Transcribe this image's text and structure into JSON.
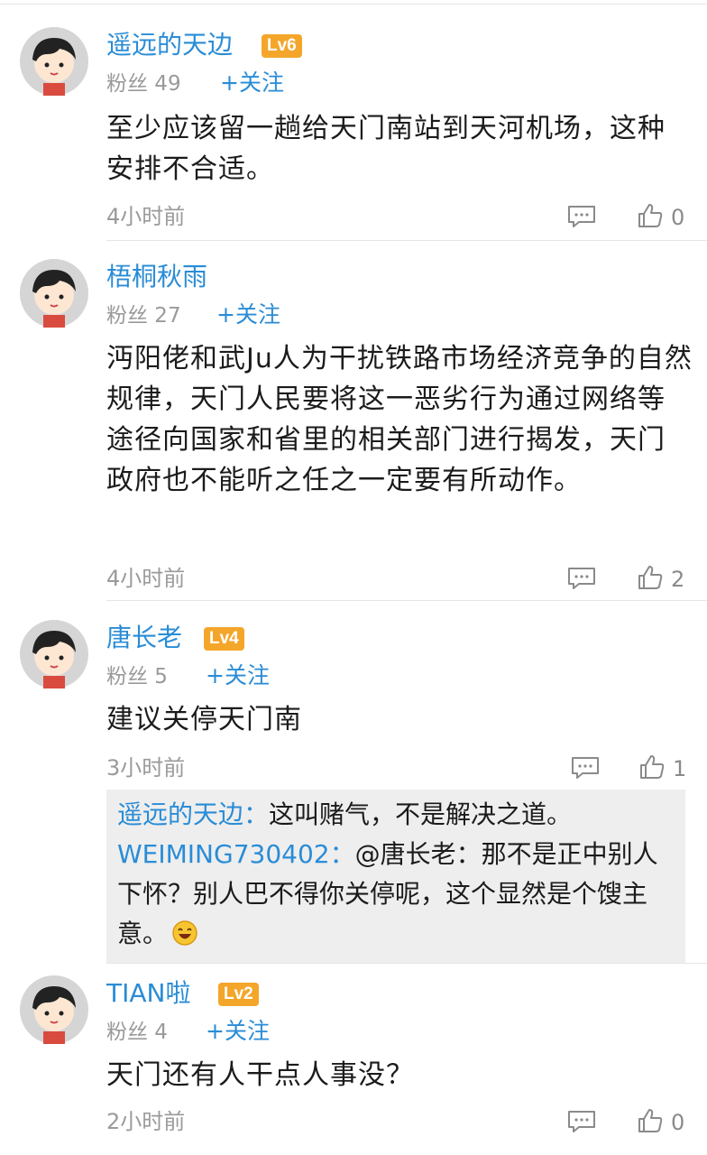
{
  "comments": [
    {
      "name": "遥远的天边",
      "level": "Lv6",
      "fans": "粉丝 49",
      "follow": "+关注",
      "content": "至少应该留一趟给天门南站到天河机场，这种安排不合适。",
      "time": "4小时前",
      "likes": "0"
    },
    {
      "name": "梧桐秋雨",
      "level": "",
      "fans": "粉丝 27",
      "follow": "+关注",
      "content": "沔阳佬和武Ju人为干扰铁路市场经济竞争的自然规律，天门人民要将这一恶劣行为通过网络等途径向国家和省里的相关部门进行揭发，天门政府也不能听之任之一定要有所动作。",
      "time": "4小时前",
      "likes": "2"
    },
    {
      "name": "唐长老",
      "level": "Lv4",
      "fans": "粉丝 5",
      "follow": "+关注",
      "content": "建议关停天门南",
      "time": "3小时前",
      "likes": "1",
      "replies": [
        {
          "author": "遥远的天边：",
          "text": "这叫赌气，不是解决之道。"
        },
        {
          "author": "WEIMING730402：",
          "text": "@唐长老：那不是正中别人下怀？别人巴不得你关停呢，这个显然是个馊主意。"
        }
      ]
    },
    {
      "name": "TIAN啦",
      "level": "Lv2",
      "fans": "粉丝 4",
      "follow": "+关注",
      "content": "天门还有人干点人事没？",
      "time": "2小时前",
      "likes": "0"
    }
  ],
  "icons": {
    "reply": "comment-bubble-icon",
    "like": "thumbs-up-icon",
    "avatar": "cartoon-avatar",
    "emoji": "laughing-emoji-icon"
  },
  "colors": {
    "name": "#2a8cd6",
    "level_badge": "#f4a62a",
    "meta": "#9a9a9a",
    "reply_bg": "#eeeeee"
  }
}
